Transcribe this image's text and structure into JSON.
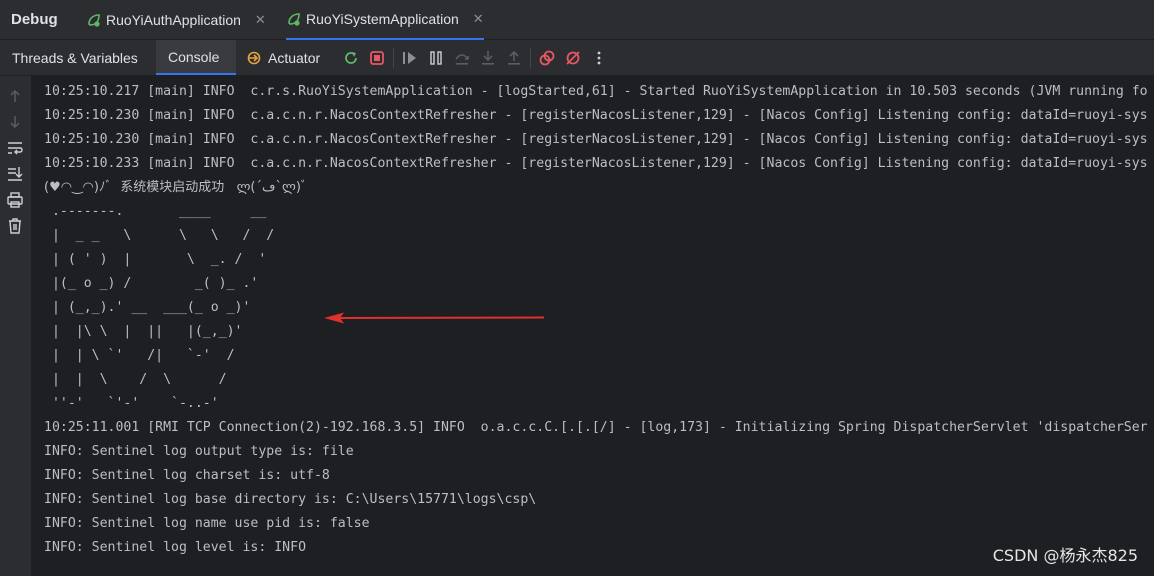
{
  "header": {
    "title": "Debug",
    "tabs": [
      {
        "label": "RuoYiAuthApplication",
        "active": false
      },
      {
        "label": "RuoYiSystemApplication",
        "active": true
      }
    ]
  },
  "toolbar": {
    "tabs": [
      "Threads & Variables",
      "Console",
      "Actuator"
    ],
    "selected": "Console",
    "icons": [
      "rerun-icon",
      "stop-icon",
      "resume-icon",
      "pause-icon",
      "step-over-icon",
      "step-into-icon",
      "step-out-icon",
      "view-breakpoints-icon",
      "mute-breakpoints-icon",
      "more-icon"
    ]
  },
  "gutter": {
    "icons": [
      "up-arrow-icon",
      "down-arrow-icon",
      "soft-wrap-icon",
      "scroll-to-end-icon",
      "print-icon",
      "clear-all-icon"
    ]
  },
  "console": {
    "lines": [
      "10:25:10.217 [main] INFO  c.r.s.RuoYiSystemApplication - [logStarted,61] - Started RuoYiSystemApplication in 10.503 seconds (JVM running fo",
      "10:25:10.230 [main] INFO  c.a.c.n.r.NacosContextRefresher - [registerNacosListener,129] - [Nacos Config] Listening config: dataId=ruoyi-sys",
      "10:25:10.230 [main] INFO  c.a.c.n.r.NacosContextRefresher - [registerNacosListener,129] - [Nacos Config] Listening config: dataId=ruoyi-sys",
      "10:25:10.233 [main] INFO  c.a.c.n.r.NacosContextRefresher - [registerNacosListener,129] - [Nacos Config] Listening config: dataId=ruoyi-sys",
      "(♥◠‿◠)ﾉﾞ  系统模块启动成功   ლ(´ڡ`ლ)ﾞ",
      " .-------.       ____     __",
      " |  _ _   \\      \\   \\   /  /",
      " | ( ' )  |       \\  _. /  '",
      " |(_ o _) /        _( )_ .'",
      " | (_,_).' __  ___(_ o _)'",
      " |  |\\ \\  |  ||   |(_,_)'",
      " |  | \\ `'   /|   `-'  /",
      " |  |  \\    /  \\      /",
      " ''-'   `'-'    `-..-'",
      "10:25:11.001 [RMI TCP Connection(2)-192.168.3.5] INFO  o.a.c.c.C.[.[.[/] - [log,173] - Initializing Spring DispatcherServlet 'dispatcherSer",
      "INFO: Sentinel log output type is: file",
      "INFO: Sentinel log charset is: utf-8",
      "INFO: Sentinel log base directory is: C:\\Users\\15771\\logs\\csp\\",
      "INFO: Sentinel log name use pid is: false",
      "INFO: Sentinel log level is: INFO"
    ]
  },
  "watermark": "CSDN @杨永杰825",
  "colors": {
    "background": "#1e1f22",
    "panel": "#2b2d30",
    "accent": "#3574f0",
    "stop": "#e55765",
    "rerun": "#5fb865",
    "arrow": "#e0322b"
  }
}
